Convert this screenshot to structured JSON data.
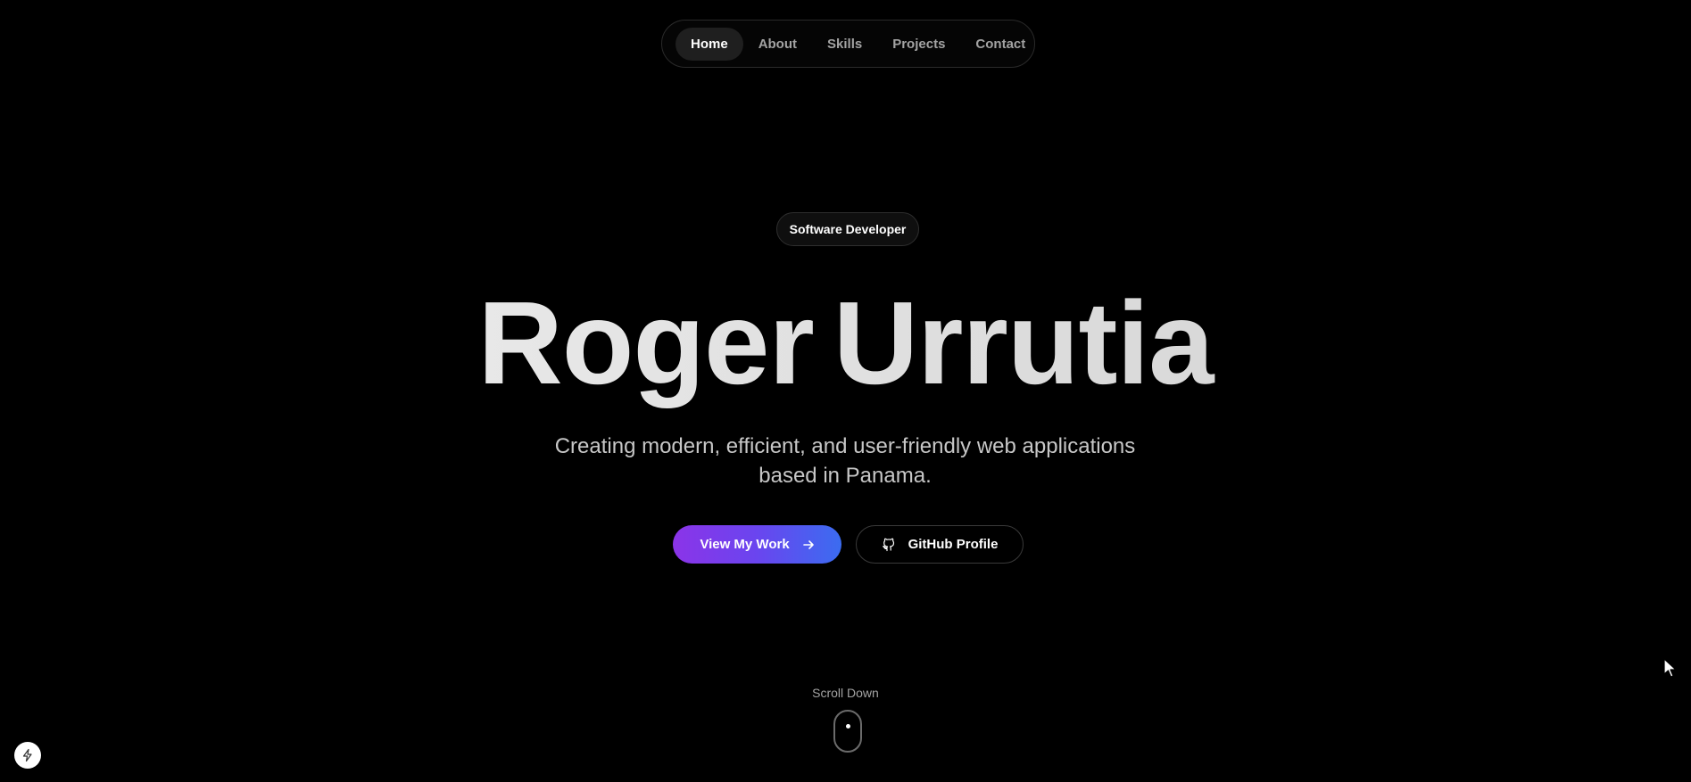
{
  "nav": {
    "items": [
      {
        "label": "Home",
        "active": true
      },
      {
        "label": "About",
        "active": false
      },
      {
        "label": "Skills",
        "active": false
      },
      {
        "label": "Projects",
        "active": false
      },
      {
        "label": "Contact",
        "active": false
      }
    ]
  },
  "hero": {
    "badge": "Software Developer",
    "first_name": "Roger",
    "last_name": "Urrutia",
    "tagline_line1": "Creating modern, efficient, and user-friendly web applications",
    "tagline_line2": "based in Panama.",
    "primary_button": {
      "label": "View My Work",
      "icon": "arrow-right-icon"
    },
    "secondary_button": {
      "label": "GitHub Profile",
      "icon": "github-icon"
    }
  },
  "scroll": {
    "label": "Scroll Down",
    "icon": "mouse-icon"
  },
  "corner_badge": {
    "icon": "bolt-icon"
  },
  "colors": {
    "background": "#000000",
    "accent_start": "#8b34e8",
    "accent_end": "#3b6cf0",
    "nav_active_bg": "#1f1f1f",
    "muted_text": "#a3a3a3"
  }
}
